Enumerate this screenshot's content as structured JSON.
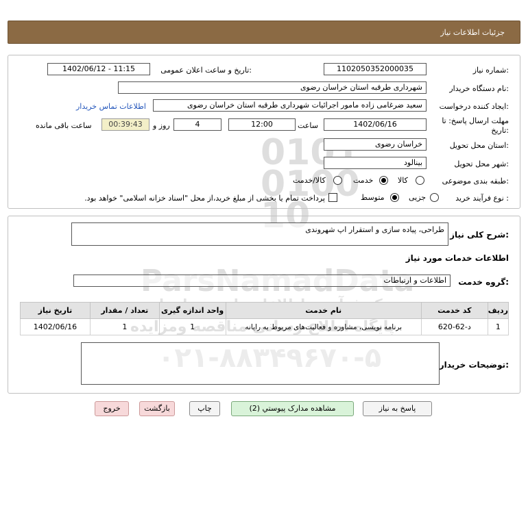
{
  "header": {
    "title": "جزئیات اطلاعات نیاز"
  },
  "form": {
    "need_number_label": "شماره نیاز:",
    "need_number": "1102050352000035",
    "announce_label": "تاریخ و ساعت اعلان عمومی:",
    "announce_value": "1402/06/12 - 11:15",
    "buyer_org_label": "نام دستگاه خریدار:",
    "buyer_org": "شهرداری طرقبه استان خراسان رضوی",
    "creator_label": "ایجاد کننده درخواست:",
    "creator": "سعید ضرغامی زاده مامور اجرائیات شهرداری طرقبه استان خراسان رضوی",
    "contact_link": "اطلاعات تماس خریدار",
    "deadline_label_1": "مهلت ارسال پاسخ: تا",
    "deadline_label_2": "تاریخ:",
    "deadline_date": "1402/06/16",
    "time_label": "ساعت",
    "deadline_time": "12:00",
    "days_value": "4",
    "days_label": "روز و",
    "remaining_value": "00:39:43",
    "remaining_label": "ساعت باقی مانده",
    "province_label": "استان محل تحویل:",
    "province": "خراسان رضوی",
    "city_label": "شهر محل تحویل:",
    "city": "بینالود",
    "category_label": "طبقه بندی موضوعی:",
    "category_options": [
      "کالا",
      "خدمت",
      "کالا/خدمت"
    ],
    "category_selected": "خدمت",
    "process_label": "نوع فرآیند خرید :",
    "process_options": [
      "جزیی",
      "متوسط"
    ],
    "process_selected": "متوسط",
    "payment_note": "پرداخت تمام یا بخشی از مبلغ خرید،از محل \"اسناد خزانه اسلامی\" خواهد بود."
  },
  "details": {
    "summary_label": "شرح کلی نیاز:",
    "summary": "طراحی، پیاده سازی و استقرار اپ شهروندی",
    "services_heading": "اطلاعات خدمات مورد نیاز",
    "service_group_label": "گروه خدمت:",
    "service_group": "اطلاعات و ارتباطات",
    "table": {
      "headers": [
        "ردیف",
        "کد خدمت",
        "نام خدمت",
        "واحد اندازه گیری",
        "تعداد / مقدار",
        "تاریخ نیاز"
      ],
      "rows": [
        [
          "1",
          "د-62-620",
          "برنامه نویسی، مشاوره و فعالیت‌های مربوط به رایانه",
          "1",
          "1",
          "1402/06/16"
        ]
      ]
    },
    "buyer_notes_label": "توضیحات خریدار:",
    "buyer_notes": ""
  },
  "watermark": {
    "digits": "0101010010",
    "brand": "ParsNamadData",
    "line1": "مرکز فرآوری اطلاعات پارس نماد داده",
    "line2": "پایگاه اطلاع رسانی مناقصه ومزایده",
    "phone": "۰۲۱-۸۸۳۴۹۶۷۰-۵"
  },
  "buttons": {
    "reply": "پاسخ به نیاز",
    "documents": "مشاهده مدارک پیوستي (2)",
    "print": "چاپ",
    "back": "بازگشت",
    "exit": "خروج"
  }
}
